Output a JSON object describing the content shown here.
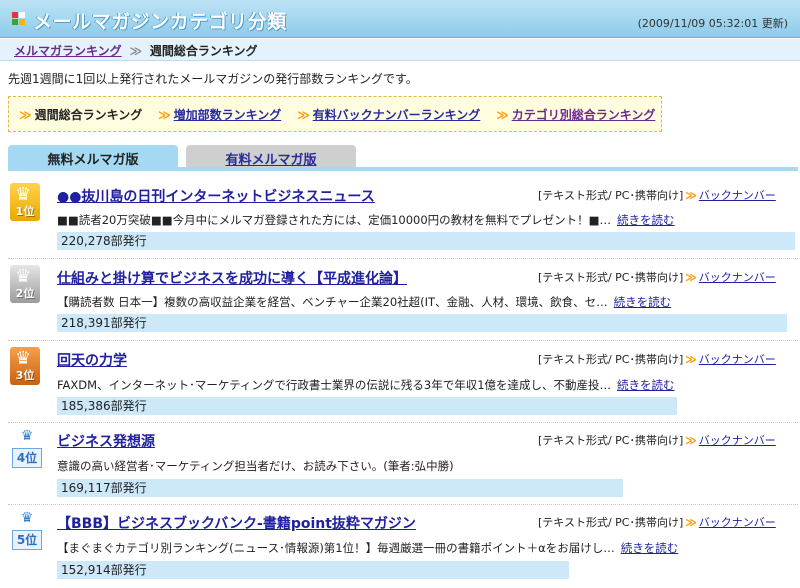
{
  "header": {
    "title": "メールマガジンカテゴリ分類",
    "updated": "(2009/11/09 05:32:01 更新)"
  },
  "breadcrumb": {
    "link": "メルマガランキング",
    "separator": "≫",
    "current": "週間総合ランキング"
  },
  "description": "先週1週間に1回以上発行されたメールマガジンの発行部数ランキングです。",
  "nav": {
    "items": [
      {
        "label": "週間総合ランキング",
        "current": true
      },
      {
        "label": "増加部数ランキング",
        "current": false
      },
      {
        "label": "有料バックナンバーランキング",
        "current": false
      },
      {
        "label": "カテゴリ別総合ランキング",
        "current": false
      }
    ]
  },
  "tabs": {
    "free": "無料メルマガ版",
    "paid": "有料メルマガ版"
  },
  "common": {
    "format": "[テキスト形式/ PC･携帯向け]",
    "backnumber": "バックナンバー",
    "read_more": "続きを読む",
    "chevron": "≫"
  },
  "entries": [
    {
      "rank": "1位",
      "title": "●●抜川島の日刊インターネットビジネスニュース",
      "summary": "■■読者20万突破■■今月中にメルマガ登録された方には、定価10000円の教材を無料でプレゼント！■…",
      "count": "220,278部発行",
      "count_value": 220278
    },
    {
      "rank": "2位",
      "title": "仕組みと掛け算でビジネスを成功に導く【平成進化論】",
      "summary": "【購読者数 日本一】複数の高収益企業を経営、ベンチャー企業20社超(IT、金融、人材、環境、飲食、セ…",
      "count": "218,391部発行",
      "count_value": 218391
    },
    {
      "rank": "3位",
      "title": "回天の力学",
      "summary": "FAXDM、インターネット･マーケティングで行政書士業界の伝説に残る3年で年収1億を達成し、不動産投…",
      "count": "185,386部発行",
      "count_value": 185386
    },
    {
      "rank": "4位",
      "title": "ビジネス発想源",
      "summary": "意識の高い経営者･マーケティング担当者だけ、お読み下さい。(筆者:弘中勝)",
      "count": "169,117部発行",
      "count_value": 169117
    },
    {
      "rank": "5位",
      "title": "【BBB】ビジネスブックバンク-書籍point抜粋マガジン",
      "summary": "【まぐまぐカテゴリ別ランキング(ニュース･情報源)第1位！】毎週厳選一冊の書籍ポイント＋αをお届けし…",
      "count": "152,914部発行",
      "count_value": 152914
    }
  ]
}
